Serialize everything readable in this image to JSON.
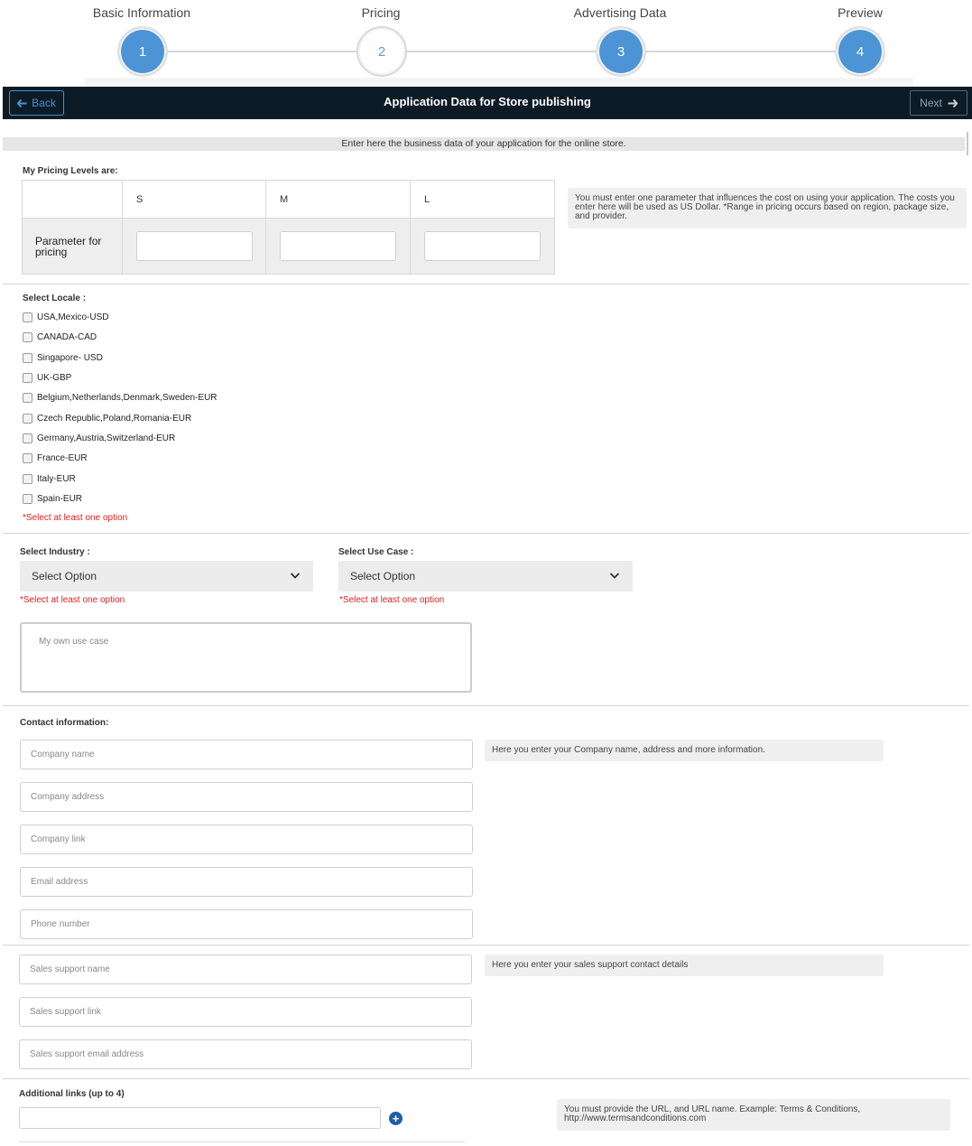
{
  "stepper": {
    "steps": [
      {
        "label": "Basic Information",
        "number": "1",
        "state": "completed"
      },
      {
        "label": "Pricing",
        "number": "2",
        "state": "current"
      },
      {
        "label": "Advertising Data",
        "number": "3",
        "state": "completed"
      },
      {
        "label": "Preview",
        "number": "4",
        "state": "completed"
      }
    ]
  },
  "toolbar": {
    "back_label": "Back",
    "title": "Application Data for Store publishing",
    "next_label": "Next"
  },
  "intro": "Enter here the business data of your application for the online store.",
  "pricing": {
    "label": "My Pricing Levels are:",
    "columns": [
      "S",
      "M",
      "L"
    ],
    "row_label": "Parameter for pricing",
    "note": "You must enter one parameter that influences the cost on using your application. The costs you enter here will be used as US Dollar. *Range in pricing occurs based on region, package size, and provider."
  },
  "locale": {
    "label": "Select Locale :",
    "options": [
      "USA,Mexico-USD",
      "CANADA-CAD",
      "Singapore- USD",
      "UK-GBP",
      "Belgium,Netherlands,Denmark,Sweden-EUR",
      "Czech Republic,Poland,Romania-EUR",
      "Germany,Austria,Switzerland-EUR",
      "France-EUR",
      "Italy-EUR",
      "Spain-EUR"
    ],
    "error": "*Select at least one option"
  },
  "industry": {
    "label": "Select Industry :",
    "value": "Select Option",
    "error": "*Select at least one option"
  },
  "use_case": {
    "label": "Select Use Case :",
    "value": "Select Option",
    "error": "*Select at least one option",
    "own_placeholder": "My own use case"
  },
  "contact": {
    "label": "Contact information:",
    "note": "Here you enter your Company name, address and more information.",
    "fields": [
      "Company name",
      "Company address",
      "Company link",
      "Email address",
      "Phone number"
    ]
  },
  "sales": {
    "note": "Here you enter your sales support contact details",
    "fields": [
      "Sales support name",
      "Sales support link",
      "Sales support email address"
    ]
  },
  "links": {
    "label": "Additional links (up to 4)",
    "note": "You must provide the URL, and URL name. Example: Terms & Conditions, http://www.termsandconditions.com"
  },
  "colors": {
    "step_active": "#4d94d6",
    "topbar": "#0d1b26",
    "error": "#e02020",
    "plus": "#1f5fad"
  }
}
